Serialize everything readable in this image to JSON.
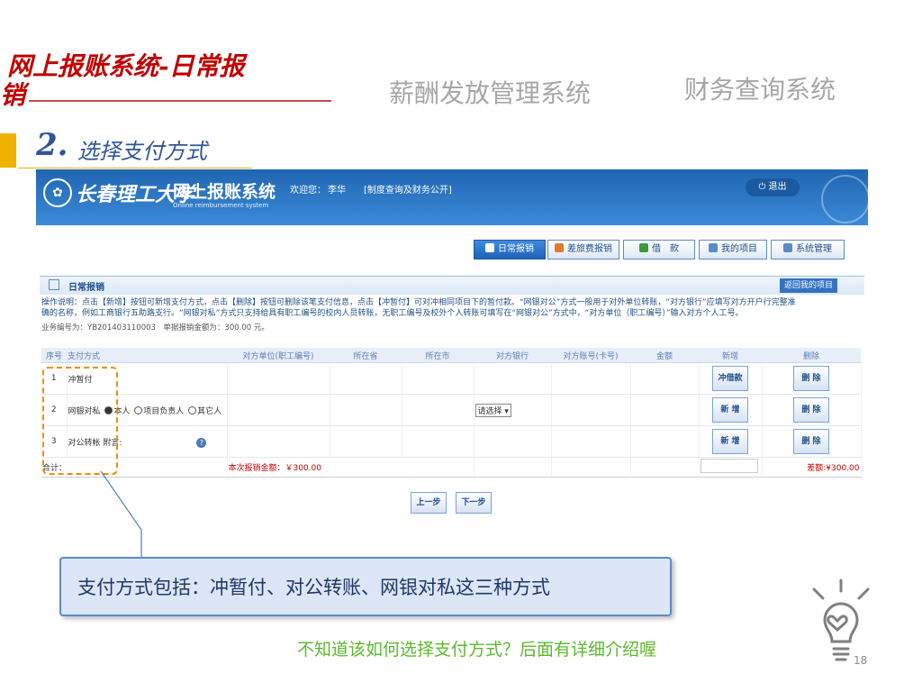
{
  "slide": {
    "title_line1": "网上报账系统-日常报",
    "title_line2": "销",
    "nav_salary": "薪酬发放管理系统",
    "nav_finance": "财务查询系统",
    "step_num": "2.",
    "step_text": "选择支付方式",
    "callout": "支付方式包括：冲暂付、对公转账、网银对私这三种方式",
    "hint": "不知道该如何选择支付方式？后面有详细介绍喔",
    "page_number": "18"
  },
  "app": {
    "university_name": "长春理工大学",
    "system_name": "网上报账系统",
    "system_sub": "Online reimbursement system",
    "welcome_label": "欢迎您：",
    "user_name": "李华",
    "policy_link": "[制度查询及财务公开]",
    "logout": "退出",
    "menu": [
      {
        "label": "日常报销",
        "color": "#ffffff"
      },
      {
        "label": "差旅费报销",
        "color": "#e07b2a"
      },
      {
        "label": "借　款",
        "color": "#3b9a3b"
      },
      {
        "label": "我的项目",
        "color": "#5a8bc4"
      },
      {
        "label": "系统管理",
        "color": "#5a8bc4"
      }
    ],
    "section_title": "日常报销",
    "back_button": "返回我的项目",
    "instructions": [
      "操作说明：点击【新增】按钮可新增支付方式，点击【删除】按钮可删除该笔支付信息，点击【冲暂付】可对冲相同项目下的暂付款。“网银对公”方式一般用于对外单位转账，“对方银行”应填写对方开户行完整准",
      "确的名称，例如工商银行五助路支行。“网银对私”方式只支持给具有职工编号的校内人员转账，无职工编号及校外个人转账可填写在“网银对公”方式中，“对方单位（职工编号）”输入对方个人工号。"
    ],
    "business_no": "业务编号为：YB201403110003　单据报销金额为：300.00 元。",
    "table": {
      "headers": [
        "序号",
        "支付方式",
        "对方单位(职工编号)",
        "所在省",
        "所在市",
        "对方银行",
        "对方账号(卡号)",
        "金额",
        "新增",
        "删除"
      ],
      "rows": [
        {
          "no": "1",
          "method": "冲暂付",
          "add": "冲借款",
          "delete": "删 除"
        },
        {
          "no": "2",
          "method": "网银对私",
          "radio_self": "本人",
          "radio_pm": "项目负责人",
          "radio_other": "其它人",
          "bank_select": "请选择",
          "add": "新 增",
          "delete": "删 除"
        },
        {
          "no": "3",
          "method": "对公转帐",
          "note_label": "附言:",
          "add": "新 增",
          "delete": "删 除"
        }
      ],
      "total_label": "合计：",
      "total_amount": "本次报销金额：￥300.00",
      "diff": "差额:¥300.00"
    },
    "prev_button": "上一步",
    "next_button": "下一步"
  }
}
